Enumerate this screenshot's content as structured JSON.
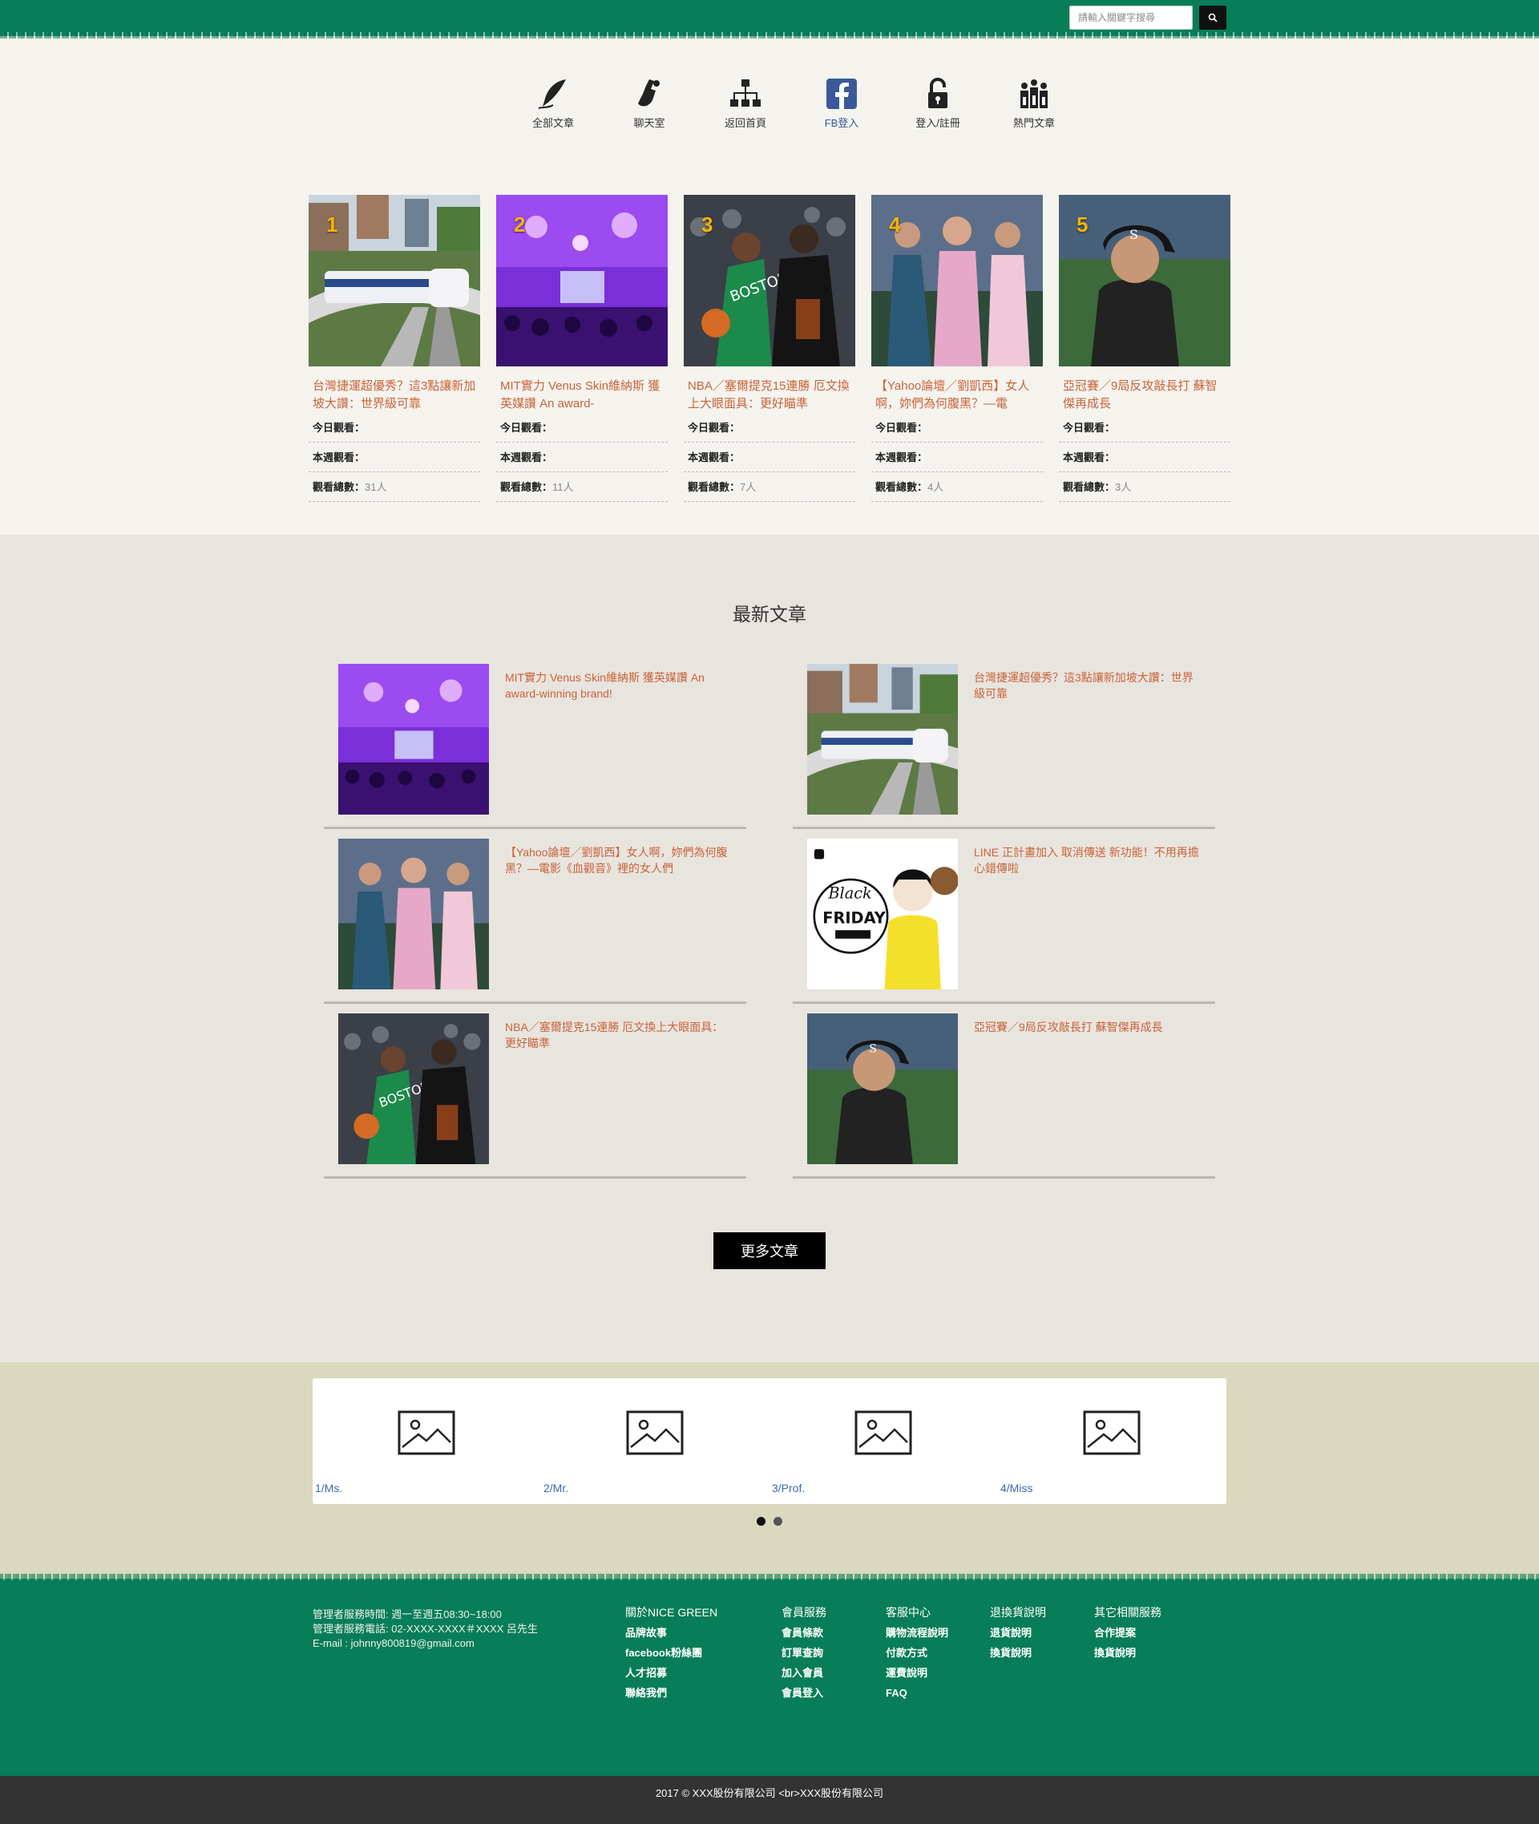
{
  "search": {
    "placeholder": "請輸入關鍵字搜尋"
  },
  "nav": [
    {
      "label": "全部文章",
      "icon": "quill-pen-icon"
    },
    {
      "label": "聊天室",
      "icon": "hand-microphone-icon"
    },
    {
      "label": "返回首頁",
      "icon": "sitemap-icon"
    },
    {
      "label": "FB登入",
      "icon": "facebook-icon"
    },
    {
      "label": "登入/註冊",
      "icon": "unlock-icon"
    },
    {
      "label": "熱門文章",
      "icon": "people-ranking-icon"
    }
  ],
  "hot": {
    "labels": {
      "today": "今日觀看：",
      "week": "本週觀看：",
      "total": "觀看總數："
    },
    "items": [
      {
        "rank": "1",
        "title": "台灣捷運超優秀？這3點讓新加坡大讚：世界級可靠",
        "today": "",
        "week": "",
        "total": "31人",
        "thumb": "train"
      },
      {
        "rank": "2",
        "title": "MIT實力 Venus Skin維納斯 獲英媒讚 An award-",
        "today": "",
        "week": "",
        "total": "11人",
        "thumb": "party"
      },
      {
        "rank": "3",
        "title": "NBA／塞爾提克15連勝 厄文換上大眼面具：更好瞄準",
        "today": "",
        "week": "",
        "total": "7人",
        "thumb": "basketball"
      },
      {
        "rank": "4",
        "title": "【Yahoo論壇／劉凱西】女人啊，妳們為何腹黑？—電",
        "today": "",
        "week": "",
        "total": "4人",
        "thumb": "women"
      },
      {
        "rank": "5",
        "title": "亞冠賽／9局反攻敲長打 蘇智傑再成長",
        "today": "",
        "week": "",
        "total": "3人",
        "thumb": "baseball"
      }
    ]
  },
  "latest": {
    "title": "最新文章",
    "posts": [
      {
        "title": "MIT實力 Venus Skin維納斯 獲英媒讚 An award-winning brand!",
        "thumb": "party"
      },
      {
        "title": "台灣捷運超優秀？這3點讓新加坡大讚：世界級可靠",
        "thumb": "train"
      },
      {
        "title": "【Yahoo論壇／劉凱西】女人啊，妳們為何腹黑？—電影《血觀音》裡的女人們",
        "thumb": "women"
      },
      {
        "title": "LINE 正計畫加入 取消傳送 新功能！不用再擔心錯傳啦",
        "thumb": "blackfriday"
      },
      {
        "title": "NBA／塞爾提克15連勝 厄文換上大眼面具：更好瞄準",
        "thumb": "basketball"
      },
      {
        "title": "亞冠賽／9局反攻敲長打 蘇智傑再成長",
        "thumb": "baseball"
      }
    ],
    "more_label": "更多文章"
  },
  "partners": [
    {
      "name": "1/Ms."
    },
    {
      "name": "2/Mr."
    },
    {
      "name": "3/Prof."
    },
    {
      "name": "4/Miss"
    }
  ],
  "footer": {
    "contact": [
      "管理者服務時間: 週一至週五08:30~18:00",
      "管理者服務電話: 02-XXXX-XXXX＃XXXX 呂先生",
      "E-mail : johnny800819@gmail.com"
    ],
    "columns": [
      {
        "head": "關於NICE GREEN",
        "links": [
          "品牌故事",
          "facebook粉絲團",
          "人才招募",
          "聯絡我們"
        ]
      },
      {
        "head": "會員服務",
        "links": [
          "會員條款",
          "訂單查詢",
          "加入會員",
          "會員登入"
        ]
      },
      {
        "head": "客服中心",
        "links": [
          "購物流程說明",
          "付款方式",
          "運費說明",
          "FAQ"
        ]
      },
      {
        "head": "退換貨說明",
        "links": [
          "退貨說明",
          "換貨說明"
        ]
      },
      {
        "head": "其它相關服務",
        "links": [
          "合作提案",
          "換貨說明"
        ]
      }
    ],
    "copyright": "2017 © XXX股份有限公司 <br>XXX股份有限公司"
  },
  "colors": {
    "brand_green": "#077d58",
    "title_orange": "#c8643a",
    "partner_band": "#dad8bd",
    "latest_bg": "#e8e4de"
  }
}
